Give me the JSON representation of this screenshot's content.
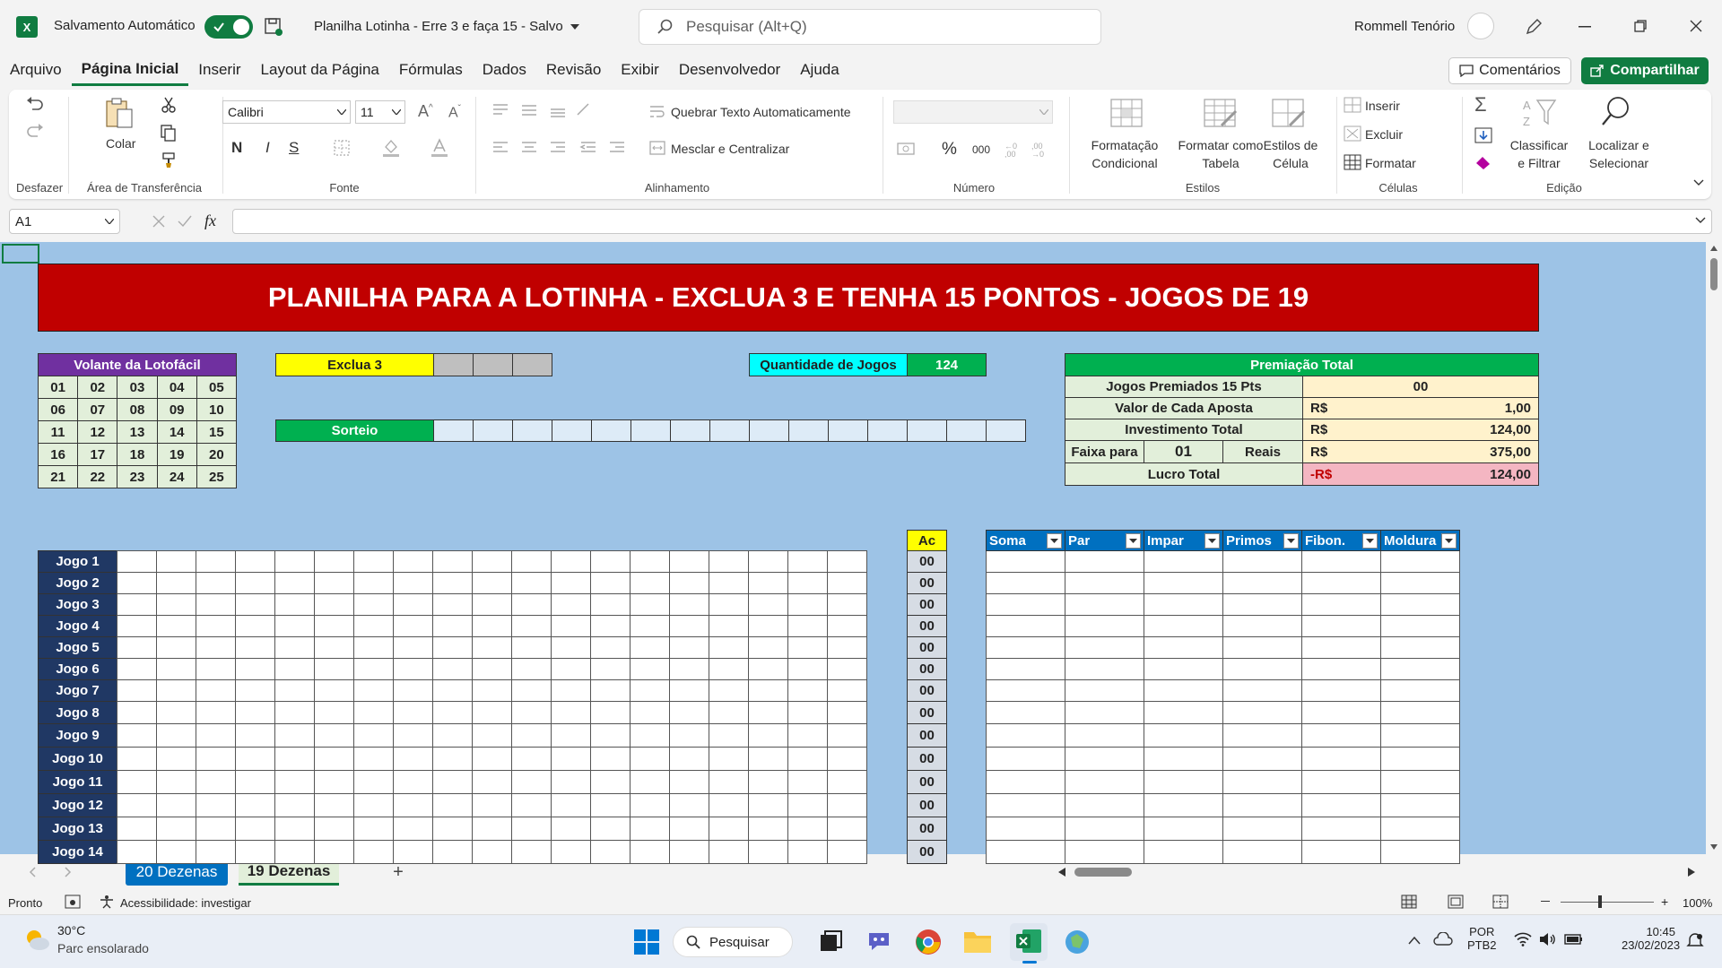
{
  "titlebar": {
    "autosave_label": "Salvamento Automático",
    "doc_title": "Planilha Lotinha - Erre 3 e faça 15  -  Salvo",
    "search_placeholder": "Pesquisar (Alt+Q)",
    "user_name": "Rommell Tenório",
    "app_letter": "X"
  },
  "menu": {
    "items": [
      "Arquivo",
      "Página Inicial",
      "Inserir",
      "Layout da Página",
      "Fórmulas",
      "Dados",
      "Revisão",
      "Exibir",
      "Desenvolvedor",
      "Ajuda"
    ],
    "comments": "Comentários",
    "share": "Compartilhar"
  },
  "ribbon": {
    "undo_group": "Desfazer",
    "paste": "Colar",
    "clipboard_group": "Área de Transferência",
    "font_name": "Calibri",
    "font_size": "11",
    "font_group": "Fonte",
    "wrap_text": "Quebrar Texto Automaticamente",
    "merge_center": "Mesclar e Centralizar",
    "alignment_group": "Alinhamento",
    "number_group": "Número",
    "cond_format_1": "Formatação",
    "cond_format_2": "Condicional",
    "format_table_1": "Formatar como",
    "format_table_2": "Tabela",
    "cell_styles_1": "Estilos de",
    "cell_styles_2": "Célula",
    "styles_group": "Estilos",
    "insert": "Inserir",
    "delete": "Excluir",
    "format": "Formatar",
    "cells_group": "Células",
    "sort_1": "Classificar",
    "sort_2": "e Filtrar",
    "find_1": "Localizar e",
    "find_2": "Selecionar",
    "editing_group": "Edição",
    "bold": "N",
    "italic": "I",
    "underline": "S",
    "percent": "%",
    "thousands": "000",
    "fx": "fx"
  },
  "formula_bar": {
    "name_box": "A1"
  },
  "sheet": {
    "title": "PLANILHA PARA A LOTINHA - EXCLUA 3 E TENHA 15 PONTOS - JOGOS DE 19",
    "volante_header": "Volante da Lotofácil",
    "volante_numbers": [
      [
        "01",
        "02",
        "03",
        "04",
        "05"
      ],
      [
        "06",
        "07",
        "08",
        "09",
        "10"
      ],
      [
        "11",
        "12",
        "13",
        "14",
        "15"
      ],
      [
        "16",
        "17",
        "18",
        "19",
        "20"
      ],
      [
        "21",
        "22",
        "23",
        "24",
        "25"
      ]
    ],
    "exclua_label": "Exclua 3",
    "sorteio_label": "Sorteio",
    "qtd_jogos_label": "Quantidade de Jogos",
    "qtd_jogos_value": "124",
    "premiacao": {
      "header": "Premiação Total",
      "jogos_premiados_label": "Jogos Premiados 15 Pts",
      "jogos_premiados_value": "00",
      "valor_aposta_label": "Valor de Cada Aposta",
      "currency": "R$",
      "valor_aposta_value": "1,00",
      "investimento_label": "Investimento Total",
      "investimento_value": "124,00",
      "faixa_label": "Faixa para",
      "faixa_value": "01",
      "reais_label": "Reais",
      "reais_value": "375,00",
      "lucro_label": "Lucro Total",
      "lucro_currency": "-R$",
      "lucro_value": "124,00"
    },
    "ac_header": "Ac",
    "jogos": [
      "Jogo 1",
      "Jogo 2",
      "Jogo 3",
      "Jogo 4",
      "Jogo 5",
      "Jogo 6",
      "Jogo 7",
      "Jogo 8",
      "Jogo 9",
      "Jogo 10",
      "Jogo 11",
      "Jogo 12",
      "Jogo 13",
      "Jogo 14"
    ],
    "ac_values": [
      "00",
      "00",
      "00",
      "00",
      "00",
      "00",
      "00",
      "00",
      "00",
      "00",
      "00",
      "00",
      "00",
      "00"
    ],
    "stats_headers": [
      "Soma",
      "Par",
      "Impar",
      "Primos",
      "Fibon.",
      "Moldura"
    ]
  },
  "tabs": {
    "items": [
      "20 Dezenas",
      "19 Dezenas"
    ],
    "add": "+"
  },
  "status": {
    "ready": "Pronto",
    "accessibility": "Acessibilidade: investigar",
    "zoom": "100%"
  },
  "taskbar": {
    "temp": "30°C",
    "weather": "Parc ensolarado",
    "search": "Pesquisar",
    "lang_1": "POR",
    "lang_2": "PTB2",
    "time": "10:45",
    "date": "23/02/2023"
  },
  "colors": {
    "excel_green": "#107c41",
    "banner_red": "#c00000",
    "volante_purple": "#7030a0",
    "yellow": "#ffff00",
    "green_header": "#00b050",
    "cyan": "#00ffff",
    "light_yellow": "#fff2cc",
    "light_green": "#e2efda",
    "lucro_pink": "#f4b6c2",
    "navy": "#203864",
    "stats_blue": "#0070c0",
    "sheet_bg": "#9dc3e6"
  }
}
